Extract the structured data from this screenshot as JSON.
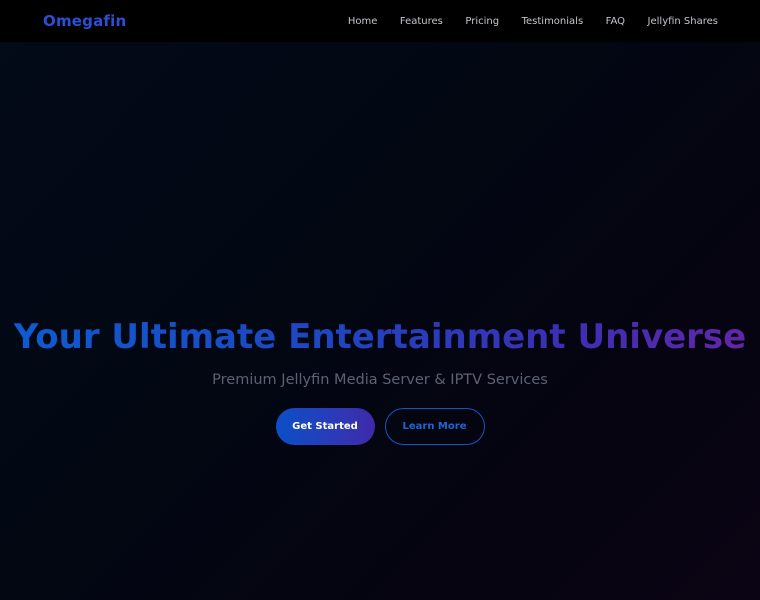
{
  "navbar": {
    "brand": "Omegafin",
    "links": [
      "Home",
      "Features",
      "Pricing",
      "Testimonials",
      "FAQ",
      "Jellyfin Shares"
    ]
  },
  "hero": {
    "title": "Your Ultimate Entertainment Universe",
    "subtitle": "Premium Jellyfin Media Server & IPTV Services",
    "primary_button": "Get Started",
    "secondary_button": "Learn More"
  },
  "colors": {
    "brand": "#2b4fd6",
    "accent_blue": "#0e5bd0",
    "accent_purple": "#6226a8",
    "background": "#020712"
  }
}
